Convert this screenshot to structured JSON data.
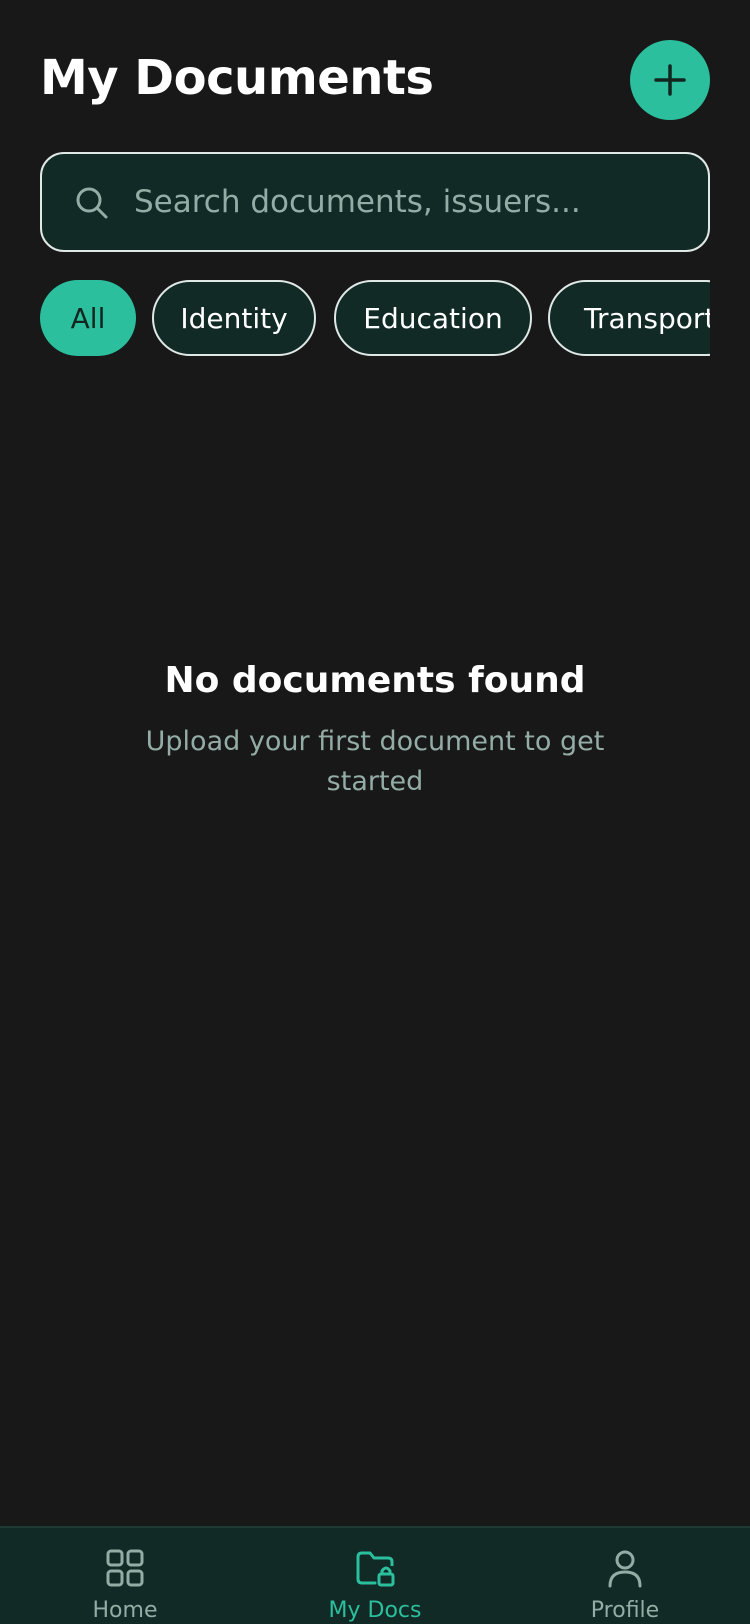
{
  "header": {
    "title": "My Documents",
    "add_icon": "plus-icon"
  },
  "search": {
    "placeholder": "Search documents, issuers...",
    "value": "",
    "icon": "search-icon"
  },
  "filters": {
    "chips": [
      {
        "label": "All",
        "active": true
      },
      {
        "label": "Identity",
        "active": false
      },
      {
        "label": "Education",
        "active": false
      },
      {
        "label": "Transport",
        "active": false
      }
    ]
  },
  "empty_state": {
    "title": "No documents found",
    "subtitle": "Upload your first document to get started"
  },
  "bottom_nav": {
    "items": [
      {
        "label": "Home",
        "icon": "grid-icon",
        "active": false
      },
      {
        "label": "My Docs",
        "icon": "folder-lock-icon",
        "active": true
      },
      {
        "label": "Profile",
        "icon": "user-icon",
        "active": false
      }
    ]
  },
  "colors": {
    "background": "#181818",
    "accent": "#2bbf9e",
    "surface": "#112a25",
    "muted_text": "#93aca5"
  }
}
